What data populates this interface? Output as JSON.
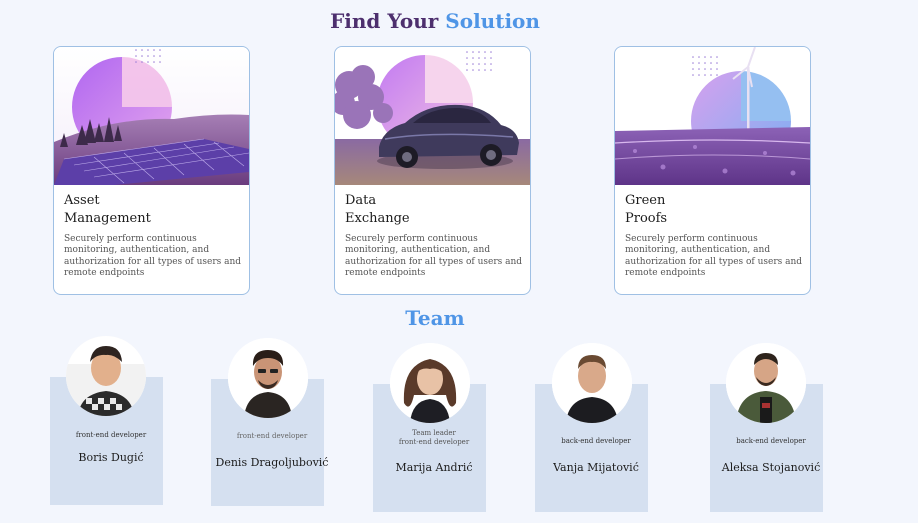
{
  "solutions": {
    "title_prefix": "Find Your",
    "title_accent": "Solution",
    "cards": [
      {
        "title_line1": "Asset",
        "title_line2": "Management",
        "description": "Securely perform continuous monitoring, authentication, and authorization for all types of users and remote endpoints"
      },
      {
        "title_line1": "Data",
        "title_line2": "Exchange",
        "description": "Securely perform continuous monitoring, authentication, and authorization for all types of users and remote endpoints"
      },
      {
        "title_line1": "Green",
        "title_line2": "Proofs",
        "description": "Securely perform continuous monitoring, authentication, and authorization for all types of users and remote endpoints"
      }
    ]
  },
  "team": {
    "title": "Team",
    "members": [
      {
        "role": "front-end developer",
        "name": "Boris Dugić"
      },
      {
        "role": "front-end developer",
        "name": "Denis Dragoljubović"
      },
      {
        "role_line1": "Team leader",
        "role": "front-end developer",
        "name": "Marija Andrić"
      },
      {
        "role": "back-end developer",
        "name": "Vanja Mijatović"
      },
      {
        "role": "back-end developer",
        "name": "Aleksa Stojanović"
      }
    ]
  },
  "colors": {
    "background": "#f3f6fd",
    "heading_dark": "#4d2f6e",
    "accent_blue": "#4f95e6",
    "card_border": "#9fc0e4",
    "team_panel": "#d5e0f0"
  }
}
